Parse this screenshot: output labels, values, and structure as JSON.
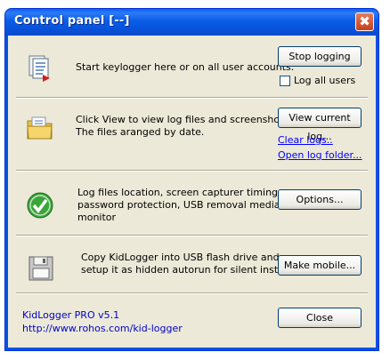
{
  "window": {
    "title": "Control panel  [--]",
    "close_glyph": "✖"
  },
  "sections": {
    "logging": {
      "icon": "document-icon",
      "text": "Start keylogger here or on all user accounts.",
      "button": "Stop logging",
      "checkbox_label": "Log all users",
      "checkbox_checked": false
    },
    "view": {
      "icon": "folder-icon",
      "text_line1": "Click View to view log files and screenshots.",
      "text_line2": "The files aranged by date.",
      "button": "View current log...",
      "link_clear": "Clear logs..",
      "link_open": "Open log folder..."
    },
    "options": {
      "icon": "check-icon",
      "text_line1": "Log files location, screen capturer timing,",
      "text_line2": "password protection, USB removal media",
      "text_line3": "monitor",
      "button": "Options..."
    },
    "mobile": {
      "icon": "floppy-icon",
      "text_line1": "Copy KidLogger into USB flash drive and",
      "text_line2": "setup it as hidden autorun for silent install.",
      "button": "Make mobile..."
    }
  },
  "footer": {
    "product": "KidLogger PRO v5.1",
    "url": "http://www.rohos.com/kid-logger",
    "close_button": "Close"
  },
  "colors": {
    "titlebar": "#0054e3",
    "dialog_bg": "#ece9d8",
    "link": "#0000ff"
  }
}
